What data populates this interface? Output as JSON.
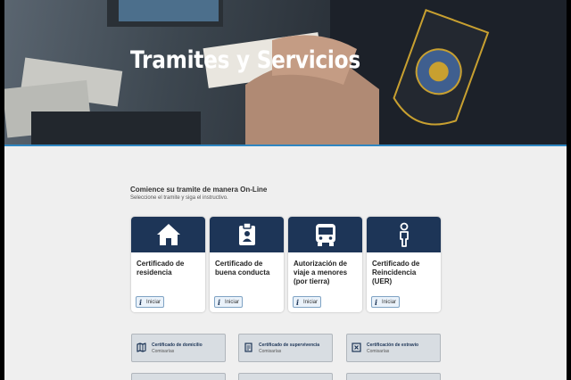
{
  "hero": {
    "title": "Tramites y Servicios"
  },
  "intro": {
    "heading": "Comience su tramite de manera On-Line",
    "subheading": "Seleccione el tramite y siga el instructivo."
  },
  "cards": [
    {
      "icon": "house-icon",
      "title": "Certificado de residencia",
      "button": "Iniciar"
    },
    {
      "icon": "clipboard-id-icon",
      "title": "Certificado de buena conducta",
      "button": "Iniciar"
    },
    {
      "icon": "bus-icon",
      "title": "Autorización de viaje a menores (por tierra)",
      "button": "Iniciar"
    },
    {
      "icon": "person-icon",
      "title": "Certificado de Reincidencia (UER)",
      "button": "Iniciar"
    }
  ],
  "services": [
    {
      "icon": "map-icon",
      "title": "Certificado de domicilio",
      "subtitle": "Comisarías"
    },
    {
      "icon": "document-icon",
      "title": "Certificado de supervivencia",
      "subtitle": "Comisarías"
    },
    {
      "icon": "x-box-icon",
      "title": "Certificación de extravío",
      "subtitle": "Comisarías"
    }
  ],
  "colors": {
    "card_header": "#1d3557",
    "accent_bar": "#2e86c1",
    "service_tile": "#d8dde2"
  }
}
